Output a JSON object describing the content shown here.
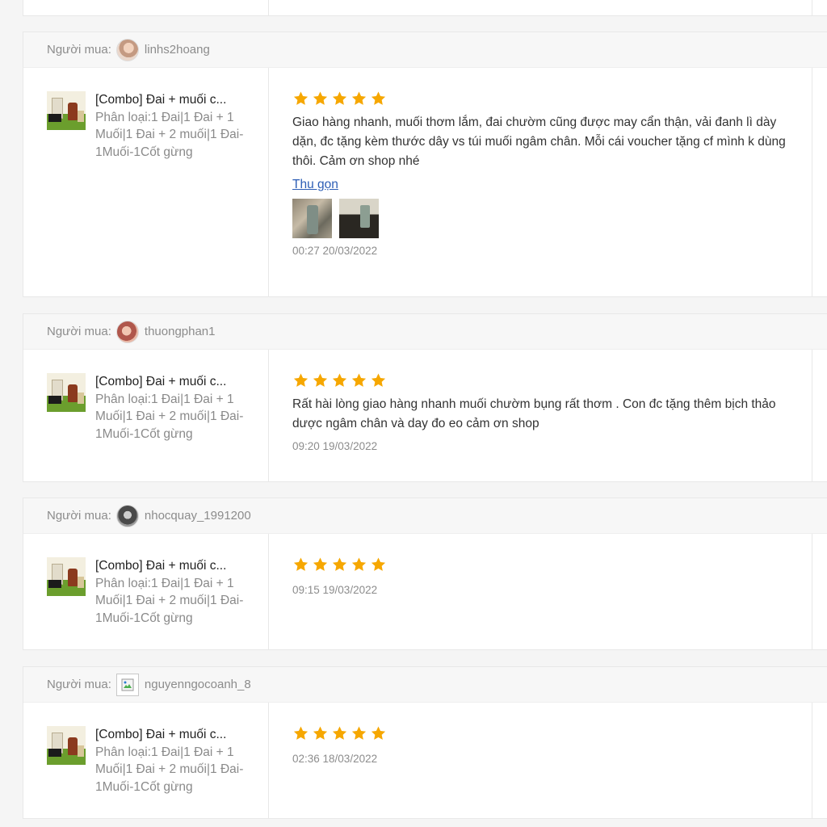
{
  "buyer_label": "Người mua:",
  "accent_star_color": "#f6a700",
  "reviews": [
    {
      "username": "linhs2hoang",
      "avatar_icon": "user-avatar",
      "product_name": "[Combo] Đai + muối c...",
      "product_variant": "Phân loại:1 Đai|1 Đai + 1 Muối|1 Đai + 2 muối|1 Đai-1Muối-1Cốt gừng",
      "rating": 5,
      "review_text": "Giao hàng nhanh, muối thơm lắm, đai chườm cũng được may cẩn thận, vải đanh lì dày dặn, đc tặng kèm thước dây vs túi muối ngâm chân. Mỗi cái voucher tặng cf mình k dùng thôi. Cảm ơn shop nhé",
      "collapse_label": "Thu gọn",
      "time": "00:27 20/03/2022"
    },
    {
      "username": "thuongphan1",
      "avatar_icon": "user-avatar",
      "product_name": "[Combo] Đai + muối c...",
      "product_variant": "Phân loại:1 Đai|1 Đai + 1 Muối|1 Đai + 2 muối|1 Đai-1Muối-1Cốt gừng",
      "rating": 5,
      "review_text": "Rất hài lòng giao hàng nhanh muối chườm bụng rất thơm . Con đc tặng thêm bịch thảo dược ngâm chân và day đo eo cảm ơn shop",
      "time": "09:20 19/03/2022"
    },
    {
      "username": "nhocquay_1991200",
      "avatar_icon": "user-avatar",
      "product_name": "[Combo] Đai + muối c...",
      "product_variant": "Phân loại:1 Đai|1 Đai + 1 Muối|1 Đai + 2 muối|1 Đai-1Muối-1Cốt gừng",
      "rating": 5,
      "time": "09:15 19/03/2022"
    },
    {
      "username": "nguyenngocoanh_8",
      "avatar_icon": "broken-image-icon",
      "product_name": "[Combo] Đai + muối c...",
      "product_variant": "Phân loại:1 Đai|1 Đai + 1 Muối|1 Đai + 2 muối|1 Đai-1Muối-1Cốt gừng",
      "rating": 5,
      "time": "02:36 18/03/2022"
    }
  ]
}
